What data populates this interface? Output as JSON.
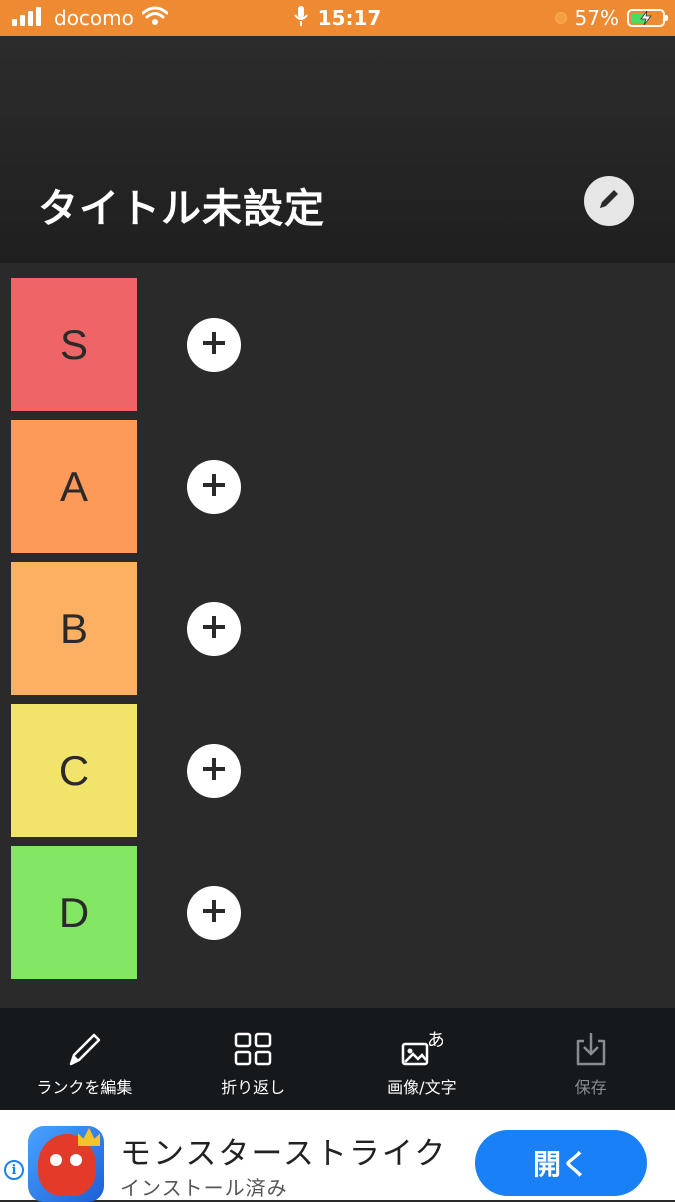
{
  "status_bar": {
    "carrier": "docomo",
    "time": "15:17",
    "battery": "57%",
    "battery_level": 0.57
  },
  "header": {
    "title": "タイトル未設定",
    "edit_icon": "pencil-icon"
  },
  "tiers": [
    {
      "label": "S",
      "color": "#ef6464"
    },
    {
      "label": "A",
      "color": "#fd9a5a"
    },
    {
      "label": "B",
      "color": "#fdaf62"
    },
    {
      "label": "C",
      "color": "#f2e36a"
    },
    {
      "label": "D",
      "color": "#82e664"
    }
  ],
  "toolbar": {
    "edit_rank": "ランクを編集",
    "wrap": "折り返し",
    "image_text": "画像/文字",
    "save": "保存"
  },
  "ad": {
    "title": "モンスターストライク",
    "subtitle": "インストール済み",
    "open_button": "開く",
    "info": "i"
  }
}
